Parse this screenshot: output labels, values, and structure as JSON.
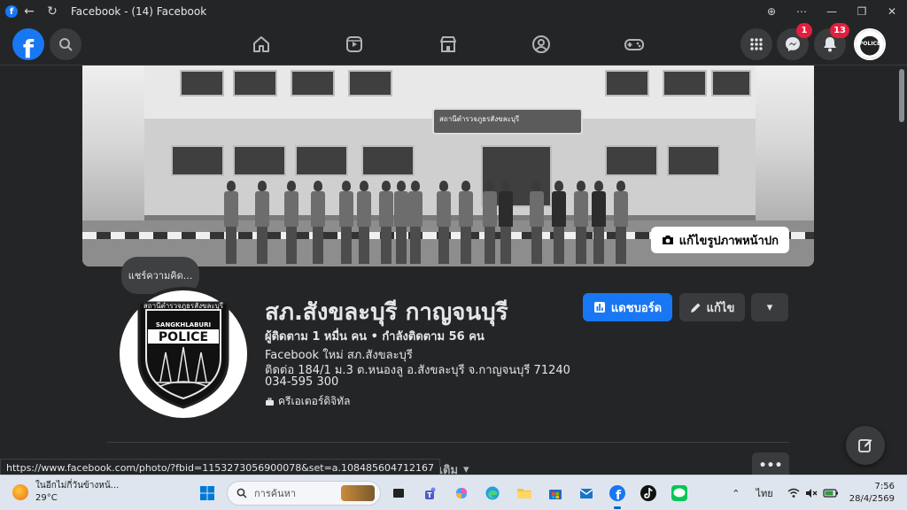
{
  "window": {
    "title": "Facebook - (14) Facebook",
    "back_icon": "arrow-left-icon",
    "reload_icon": "reload-icon"
  },
  "fbnav": {
    "logo": "f",
    "messenger_badge": "1",
    "notifications_badge": "13",
    "avatar_text": "POLICE"
  },
  "cover": {
    "sign_text": "สถานีตำรวจภูธรสังขละบุรี",
    "edit_cover_label": "แก้ไขรูปภาพหน้าปก"
  },
  "tooltip": "แชร์ความคิด...",
  "profile": {
    "name": "สภ.สังขละบุรี กาญจนบุรี",
    "followers": "ผู้ติดตาม 1 หมื่น คน • กำลังติดตาม 56 คน",
    "line1": "Facebook ใหม่ สภ.สังขละบุรี",
    "line2": "ติดต่อ 184/1 ม.3 ต.หนองลู อ.สังขละบุรี จ.กาญจนบุรี 71240",
    "phone": "034-595 300",
    "category": "ครีเอเตอร์ดิจิทัล",
    "pp_arc_text": "สถานีตำรวจภูธรสังขละบุรี",
    "pp_top_text": "SANGKHLABURI",
    "pp_main_text": "POLICE"
  },
  "buttons": {
    "dashboard": "แดชบอร์ด",
    "edit": "แก้ไข",
    "more_dropdown": "▾"
  },
  "tabs": {
    "more": "เพิ่มเติม",
    "more_caret": "▾",
    "ellipsis": "•••"
  },
  "status_url": "https://www.facebook.com/photo/?fbid=1153273056900078&set=a.108485604712167",
  "taskbar": {
    "weather_desc": "ในอีกไม่กี่วันข้างหน้...",
    "weather_temp": "29°C",
    "search_placeholder": "การค้นหา",
    "lang": "ไทย",
    "time": "7:56",
    "date": "28/4/2569"
  }
}
